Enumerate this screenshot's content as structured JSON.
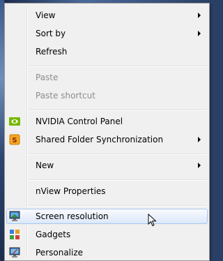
{
  "menu": {
    "items": [
      {
        "label": "View",
        "mnemonic": "V",
        "submenu": true
      },
      {
        "label": "Sort by",
        "mnemonic": "o",
        "submenu": true
      },
      {
        "label": "Refresh",
        "mnemonic": "e",
        "submenu": false
      },
      {
        "label": "Paste",
        "mnemonic": "P",
        "disabled": true
      },
      {
        "label": "Paste shortcut",
        "mnemonic": "s",
        "disabled": true
      },
      {
        "label": "NVIDIA Control Panel",
        "icon": "nvidia-icon"
      },
      {
        "label": "Shared Folder Synchronization",
        "icon": "sync-icon",
        "submenu": true
      },
      {
        "label": "New",
        "mnemonic": "w",
        "submenu": true
      },
      {
        "label": "nView Properties"
      },
      {
        "label": "Screen resolution",
        "icon": "screen-resolution-icon",
        "highlighted": true
      },
      {
        "label": "Gadgets",
        "icon": "gadgets-icon"
      },
      {
        "label": "Personalize",
        "icon": "personalize-icon"
      }
    ]
  },
  "colors": {
    "menu_background": "#f0f0f0",
    "highlight_border": "#a8c8ef",
    "disabled_text": "#8d8d8d"
  }
}
